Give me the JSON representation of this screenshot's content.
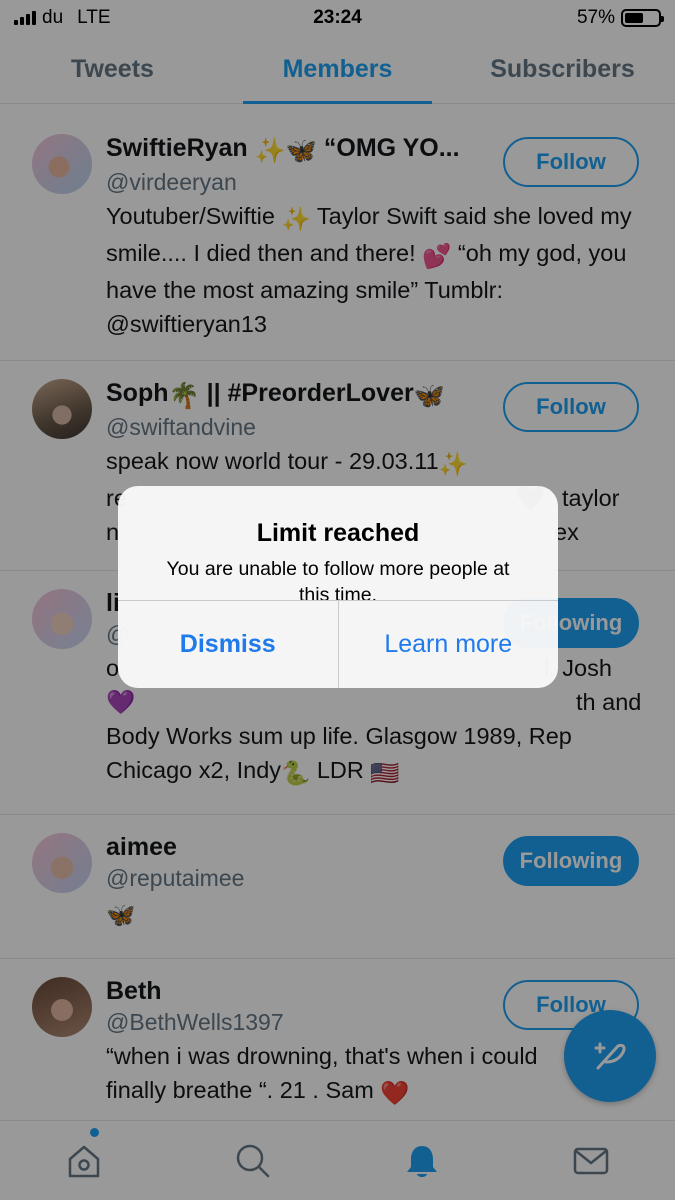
{
  "status_bar": {
    "carrier": "du",
    "network": "LTE",
    "time": "23:24",
    "battery_percent_label": "57%",
    "battery_level": 0.57
  },
  "tabs": [
    {
      "label": "Tweets",
      "active": false
    },
    {
      "label": "Members",
      "active": true
    },
    {
      "label": "Subscribers",
      "active": false
    }
  ],
  "members": [
    {
      "name": "SwiftieRyan",
      "name_suffix": "“OMG YO...",
      "handle": "@virdeeryan",
      "bio_1": "Youtuber/Swiftie",
      "bio_2": " Taylor Swift said she loved my smile.... I died then and there! ",
      "bio_3": " “oh my god, you have the most amazing smile” Tumblr: @swiftieryan13",
      "button": "Follow"
    },
    {
      "name": "Soph",
      "name_suffix": " || #PreorderLover",
      "handle": "@swiftandvine",
      "bio": "speak now world tour - 29.03.11",
      "bio_more": "taylor",
      "bio_more_2": "ex",
      "button": "Follow"
    },
    {
      "name": "li",
      "handle": "@",
      "bio_1": "o",
      "bio_1_end": "l. Josh",
      "bio_2_end": "th and",
      "bio_3": "Body Works sum up life. Glasgow 1989, Rep Chicago x2, Indy",
      "bio_4": " LDR",
      "button": "Following"
    },
    {
      "name": "aimee",
      "handle": "@reputaimee",
      "button": "Following"
    },
    {
      "name": "Beth",
      "handle": "@BethWells1397",
      "bio": "“when i was drowning, that's when i could finally breathe “. 21 . Sam ",
      "button": "Follow"
    }
  ],
  "alert": {
    "title": "Limit reached",
    "message": "You are unable to follow more people at this time.",
    "dismiss": "Dismiss",
    "learn_more": "Learn more"
  },
  "nav": [
    "home-icon",
    "search-icon",
    "notifications-icon",
    "messages-icon"
  ],
  "colors": {
    "accent": "#1da1f2",
    "alert_button": "#1f7aec",
    "overlay": "rgba(0,0,0,0.4)"
  }
}
